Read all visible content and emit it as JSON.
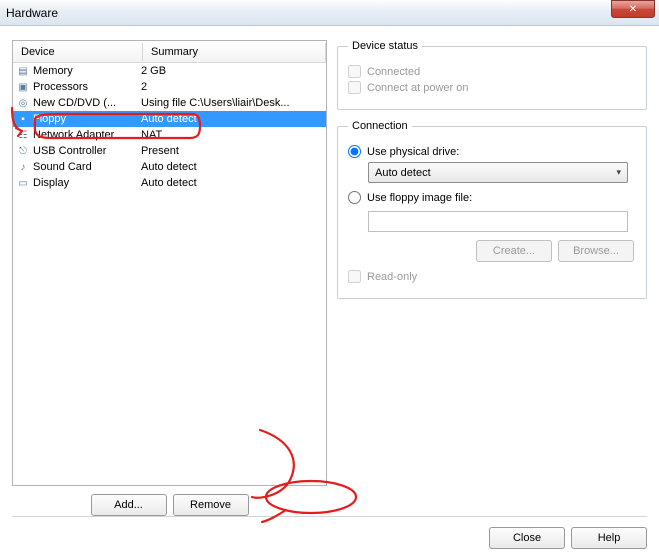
{
  "window": {
    "title": "Hardware"
  },
  "deviceList": {
    "headers": {
      "device": "Device",
      "summary": "Summary"
    },
    "rows": [
      {
        "icon": "memory-icon",
        "glyph": "▤",
        "name": "Memory",
        "summary": "2 GB",
        "selected": false
      },
      {
        "icon": "cpu-icon",
        "glyph": "▣",
        "name": "Processors",
        "summary": "2",
        "selected": false
      },
      {
        "icon": "disc-icon",
        "glyph": "◎",
        "name": "New CD/DVD (...",
        "summary": "Using file C:\\Users\\liair\\Desk...",
        "selected": false
      },
      {
        "icon": "floppy-icon",
        "glyph": "▪",
        "name": "Floppy",
        "summary": "Auto detect",
        "selected": true
      },
      {
        "icon": "network-icon",
        "glyph": "☷",
        "name": "Network Adapter",
        "summary": "NAT",
        "selected": false
      },
      {
        "icon": "usb-icon",
        "glyph": "⎋",
        "name": "USB Controller",
        "summary": "Present",
        "selected": false
      },
      {
        "icon": "sound-icon",
        "glyph": "♪",
        "name": "Sound Card",
        "summary": "Auto detect",
        "selected": false
      },
      {
        "icon": "display-icon",
        "glyph": "▭",
        "name": "Display",
        "summary": "Auto detect",
        "selected": false
      }
    ]
  },
  "buttons": {
    "add": "Add...",
    "remove": "Remove",
    "close": "Close",
    "help": "Help",
    "create": "Create...",
    "browse": "Browse..."
  },
  "deviceStatus": {
    "legend": "Device status",
    "connected": "Connected",
    "connectAtPowerOn": "Connect at power on"
  },
  "connection": {
    "legend": "Connection",
    "usePhysical": "Use physical drive:",
    "physicalValue": "Auto detect",
    "useImage": "Use floppy image file:",
    "imagePath": "",
    "readOnly": "Read-only"
  }
}
